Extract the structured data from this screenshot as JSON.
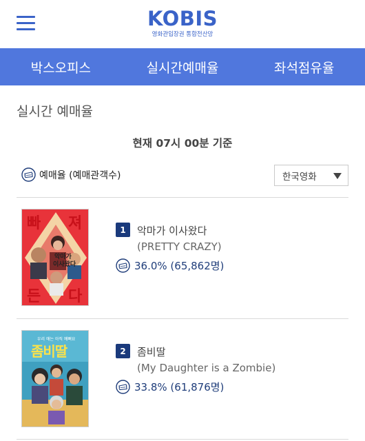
{
  "header": {
    "logo_main": "KOBIS",
    "logo_sub": "영화관입장권 통합전산망",
    "menu_icon": "hamburger-menu-icon"
  },
  "nav": {
    "items": [
      {
        "label": "박스오피스"
      },
      {
        "label": "실시간예매율"
      },
      {
        "label": "좌석점유율"
      }
    ]
  },
  "page": {
    "title": "실시간 예매율",
    "time_label": "현재  07시 00분  기준"
  },
  "legend": {
    "label": "예매율 (예매관객수)",
    "icon": "ticket-icon"
  },
  "filter": {
    "selected": "한국영화"
  },
  "colors": {
    "brand": "#3a63c8",
    "nav_bg": "#5077dd",
    "badge_bg": "#1a3a7c",
    "rate_text": "#1f3d7a"
  },
  "movies": [
    {
      "rank": "1",
      "title": "악마가 이사왔다",
      "subtitle": "(PRETTY CRAZY)",
      "rate": "36.0% (65,862명)",
      "poster_text": [
        "빠",
        "져",
        "든",
        "다"
      ]
    },
    {
      "rank": "2",
      "title": "좀비딸",
      "subtitle": "(My Daughter is a Zombie)",
      "rate": "33.8% (61,876명)",
      "poster_text": "좀비딸"
    }
  ]
}
